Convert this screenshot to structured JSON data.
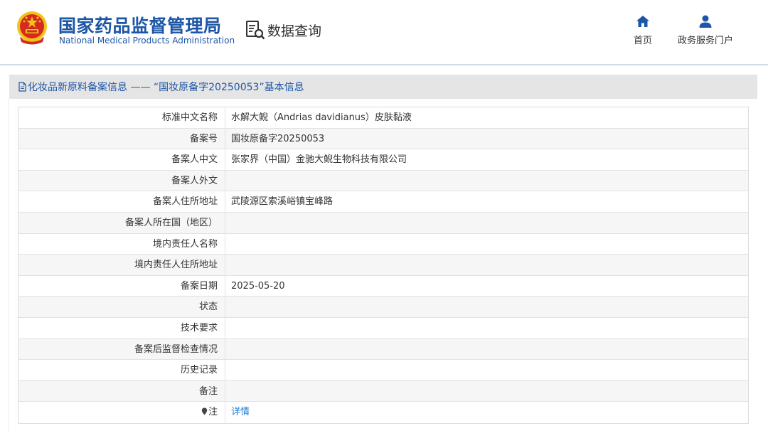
{
  "header": {
    "title_cn": "国家药品监督管理局",
    "title_en": "National Medical Products Administration",
    "data_query": "数据查询",
    "nav_home": "首页",
    "nav_portal": "政务服务门户"
  },
  "section": {
    "title": "化妆品新原料备案信息 —— “国妆原备字20250053”基本信息"
  },
  "rows": [
    {
      "label": "标准中文名称",
      "value": "水解大鲵（Andrias davidianus）皮肤黏液"
    },
    {
      "label": "备案号",
      "value": "国妆原备字20250053"
    },
    {
      "label": "备案人中文",
      "value": "张家界（中国）金驰大鲵生物科技有限公司"
    },
    {
      "label": "备案人外文",
      "value": ""
    },
    {
      "label": "备案人住所地址",
      "value": "武陵源区索溪峪镇宝峰路"
    },
    {
      "label": "备案人所在国（地区）",
      "value": ""
    },
    {
      "label": "境内责任人名称",
      "value": ""
    },
    {
      "label": "境内责任人住所地址",
      "value": ""
    },
    {
      "label": "备案日期",
      "value": "2025-05-20"
    },
    {
      "label": "状态",
      "value": ""
    },
    {
      "label": "技术要求",
      "value": ""
    },
    {
      "label": "备案后监督检查情况",
      "value": ""
    },
    {
      "label": "历史记录",
      "value": ""
    },
    {
      "label": "备注",
      "value": ""
    },
    {
      "label": "注",
      "value": "详情"
    }
  ],
  "colors": {
    "brand_blue": "#1d56a6",
    "link_blue": "#1d7fd4",
    "section_bg": "#e5e5e5",
    "emblem_red": "#d42a20",
    "emblem_gold": "#f2c318"
  },
  "icons": {
    "emblem": "national-emblem-icon",
    "data_query": "document-search-icon",
    "home": "home-icon",
    "portal": "user-icon",
    "section": "document-icon",
    "note": "location-pin-icon"
  }
}
